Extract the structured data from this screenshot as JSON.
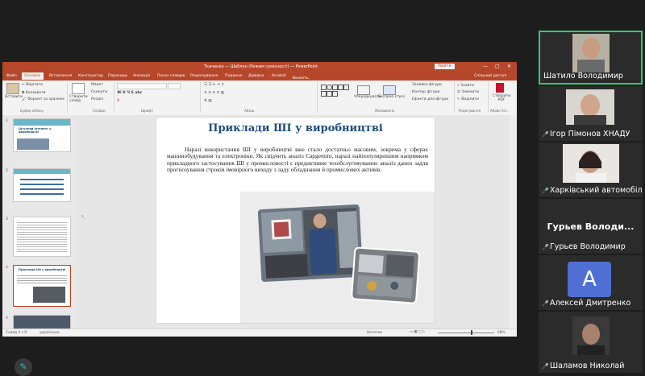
{
  "ppt": {
    "title": "Ткаченко — Шаблон (Режим сумісності) — PowerPoint",
    "signin": "Увійти",
    "window_controls": [
      "—",
      "□",
      "✕"
    ],
    "tabs": [
      "Файл",
      "Основне",
      "Вставлення",
      "Конструктор",
      "Переходи",
      "Анімація",
      "Показ слайдів",
      "Рецензування",
      "Подання",
      "Довідка",
      "Acrobat"
    ],
    "active_tab": "Основне",
    "tell_me": "Скажіть, що потрібно зробити",
    "share": "Спільний доступ",
    "ribbon": {
      "paste": "Вставити",
      "cut": "Вирізати",
      "copy": "Копіювати",
      "format_painter": "Формат за зразком",
      "new_slide": "Створити слайд",
      "layout": "Макет",
      "reset": "Скинути",
      "section": "Розділ",
      "arrange": "Упорядкувати",
      "quick_styles": "Експрес-стилі",
      "shape_fill": "Заливка фігури",
      "shape_outline": "Контур фігури",
      "shape_effects": "Ефекти для фігури",
      "find": "Знайти",
      "replace": "Замінити",
      "select": "Виділити",
      "create_pdf": "Створити PDF",
      "groups": [
        "Буфер обміну",
        "Слайди",
        "Шрифт",
        "Абзац",
        "Малювання",
        "Редагування",
        "Adobe Acr..."
      ]
    },
    "thumbnails": [
      {
        "num": "1",
        "title": "Штучний інтелект у виробництві"
      },
      {
        "num": "2",
        "title": ""
      },
      {
        "num": "3",
        "title": ""
      },
      {
        "num": "4",
        "title": "Приклади ШІ у виробництві"
      },
      {
        "num": "5",
        "title": ""
      }
    ],
    "slide": {
      "title": "Приклади ШІ у виробництві",
      "body": "Наразі використання ШІ у виробництві вже стало достатньо масовим, зокрема у сферах машинобудування та електроніки. Як свідчить аналіз Capgemini, наразі найпопулярнішим напрямком прикладного застосування ШІ у промисловості є предиктивне техобслуговування: аналіз даних задля прогнозування строків імовірного виходу з ладу обладнання й промислових активів."
    },
    "status": {
      "slide_info": "Слайд 4 з 9",
      "language": "українська",
      "notes": "Нотатки",
      "zoom": "68%"
    }
  },
  "participants": [
    {
      "name": "Шатило Володимир",
      "muted": false,
      "type": "video"
    },
    {
      "name": "Ігор Пімонов ХНАДУ",
      "muted": true,
      "type": "video"
    },
    {
      "name": "Харківський автомобіл...",
      "muted": true,
      "type": "video"
    },
    {
      "name": "Гурьев Володимир",
      "big_label": "Гурьев  Володи...",
      "muted": true,
      "type": "name"
    },
    {
      "name": "Алексей Дмитренко",
      "initial": "A",
      "muted": true,
      "type": "avatar"
    },
    {
      "name": "Шаламов Николай",
      "muted": true,
      "type": "video"
    }
  ],
  "colors": {
    "ppt_accent": "#b7472a",
    "slide_title": "#1f4e79",
    "active_tile_border": "#2ecc71",
    "muted_mic": "#e53935"
  }
}
